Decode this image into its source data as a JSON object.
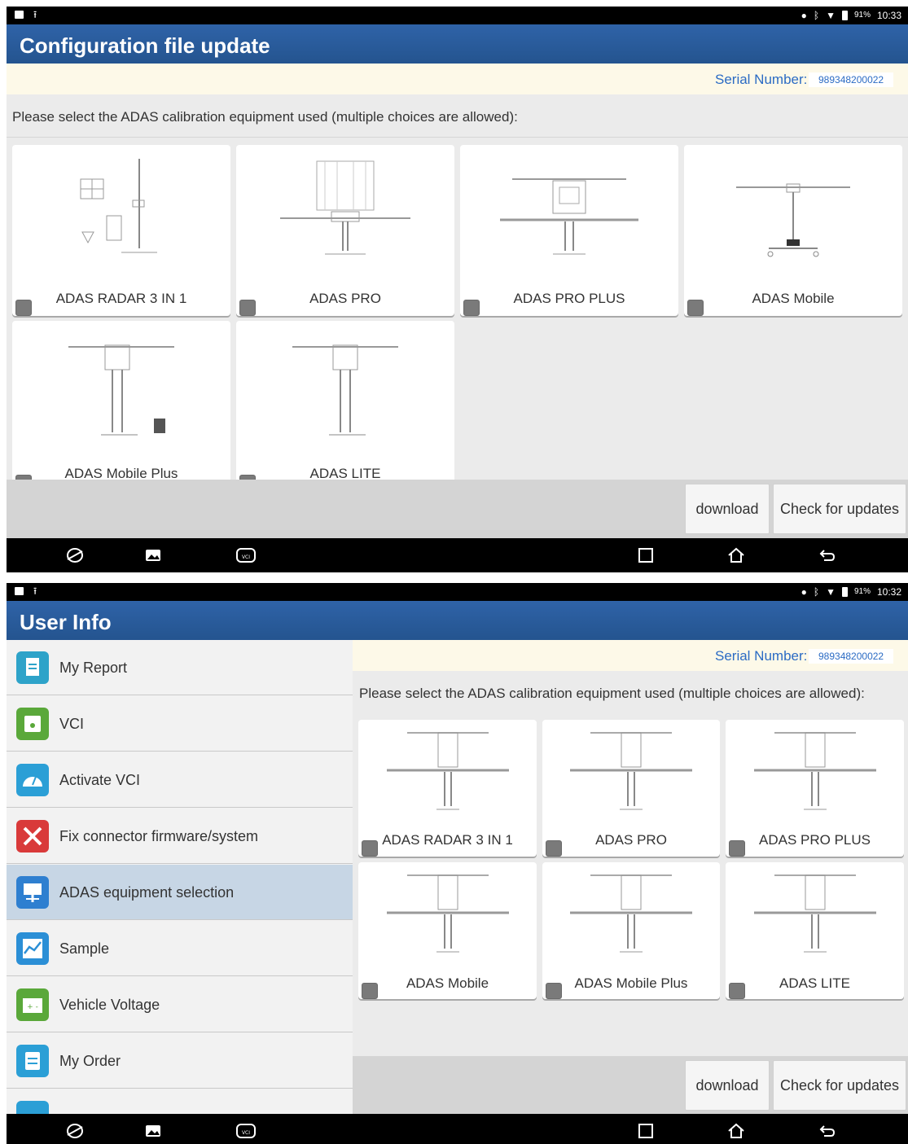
{
  "status": {
    "battery": "91%",
    "time1": "10:33",
    "time2": "10:32"
  },
  "screen1": {
    "title": "Configuration file update",
    "serial_label": "Serial Number:",
    "serial_value": "989348200022",
    "prompt": "Please select the ADAS calibration equipment used (multiple choices are allowed):",
    "cards": [
      {
        "label": "ADAS RADAR 3 IN 1"
      },
      {
        "label": "ADAS PRO"
      },
      {
        "label": "ADAS PRO PLUS"
      },
      {
        "label": "ADAS Mobile"
      },
      {
        "label": "ADAS Mobile Plus"
      },
      {
        "label": "ADAS LITE"
      }
    ],
    "download_label": "download",
    "check_label": "Check for updates"
  },
  "screen2": {
    "title": "User Info",
    "serial_label": "Serial Number:",
    "serial_value": "989348200022",
    "prompt": "Please select the ADAS calibration equipment used (multiple choices are allowed):",
    "sidebar": {
      "items": [
        {
          "label": "My Report",
          "icon": "report-icon",
          "color": "#2ea3c9"
        },
        {
          "label": "VCI",
          "icon": "vci-icon",
          "color": "#5aa83a"
        },
        {
          "label": "Activate VCI",
          "icon": "speedometer-icon",
          "color": "#2b9fd6"
        },
        {
          "label": "Fix connector firmware/system",
          "icon": "tools-icon",
          "color": "#d93a3a"
        },
        {
          "label": "ADAS equipment selection",
          "icon": "adas-icon",
          "color": "#2e7fd0"
        },
        {
          "label": "Sample",
          "icon": "chart-icon",
          "color": "#2b8fd6"
        },
        {
          "label": "Vehicle Voltage",
          "icon": "battery-icon",
          "color": "#5aa83a"
        },
        {
          "label": "My Order",
          "icon": "order-icon",
          "color": "#2b9fd6"
        }
      ]
    },
    "cards": [
      {
        "label": "ADAS RADAR 3 IN 1"
      },
      {
        "label": "ADAS PRO"
      },
      {
        "label": "ADAS PRO PLUS"
      },
      {
        "label": "ADAS Mobile"
      },
      {
        "label": "ADAS Mobile Plus"
      },
      {
        "label": "ADAS LITE"
      }
    ],
    "download_label": "download",
    "check_label": "Check for updates"
  }
}
